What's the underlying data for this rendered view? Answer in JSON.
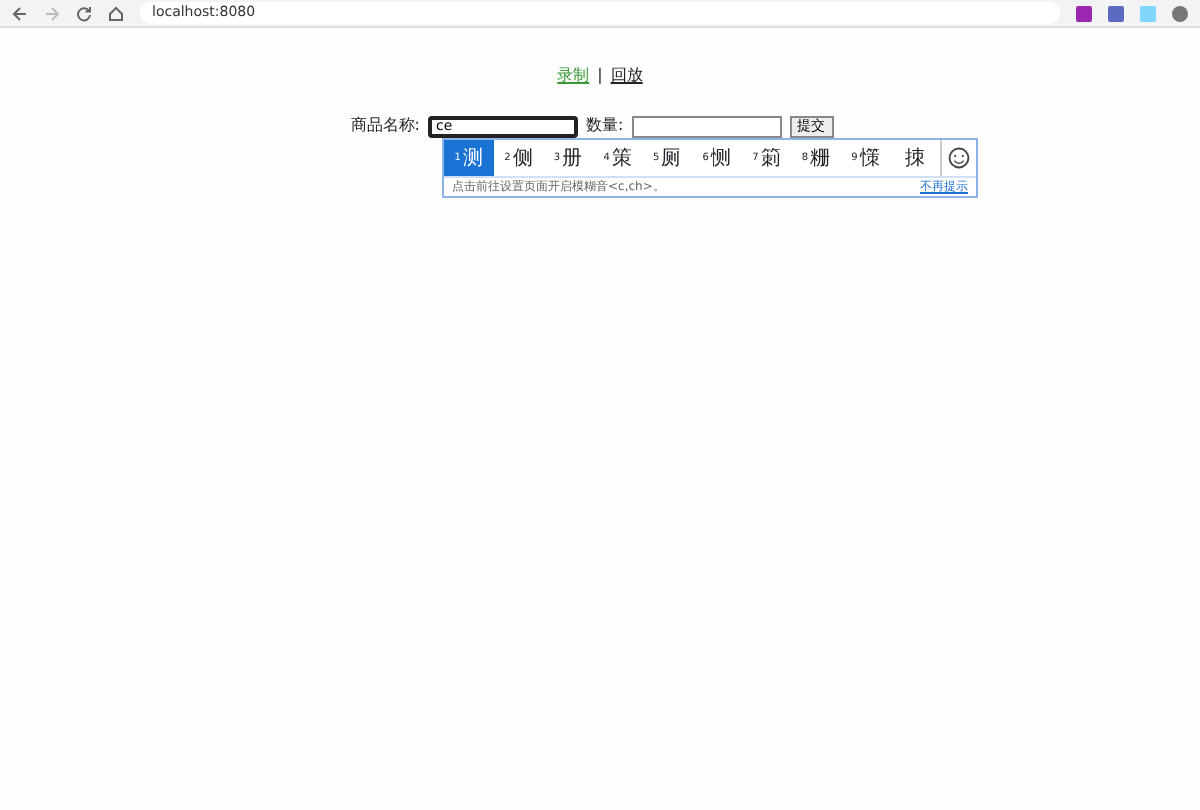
{
  "browser": {
    "url": "localhost:8080"
  },
  "nav": {
    "links": [
      {
        "label": "录制",
        "selected": true
      },
      {
        "label": "回放",
        "selected": false
      }
    ],
    "separator": "|"
  },
  "form": {
    "name_label": "商品名称:",
    "name_value": "ce",
    "qty_label": "数量:",
    "submit": "提交"
  },
  "ime": {
    "candidates": [
      {
        "index": "1",
        "text": "测",
        "selected": true
      },
      {
        "index": "2",
        "text": "侧",
        "selected": false
      },
      {
        "index": "3",
        "text": "册",
        "selected": false
      },
      {
        "index": "4",
        "text": "策",
        "selected": false
      },
      {
        "index": "5",
        "text": "厕",
        "selected": false
      },
      {
        "index": "6",
        "text": "恻",
        "selected": false
      },
      {
        "index": "7",
        "text": "箣",
        "selected": false
      },
      {
        "index": "8",
        "text": "粣",
        "selected": false
      },
      {
        "index": "9",
        "text": "憡",
        "selected": false
      },
      {
        "text": "拺",
        "selected": false
      }
    ],
    "hint": "点击前往设置页面开启模糊音<c,ch>。",
    "dismiss": "不再提示"
  }
}
